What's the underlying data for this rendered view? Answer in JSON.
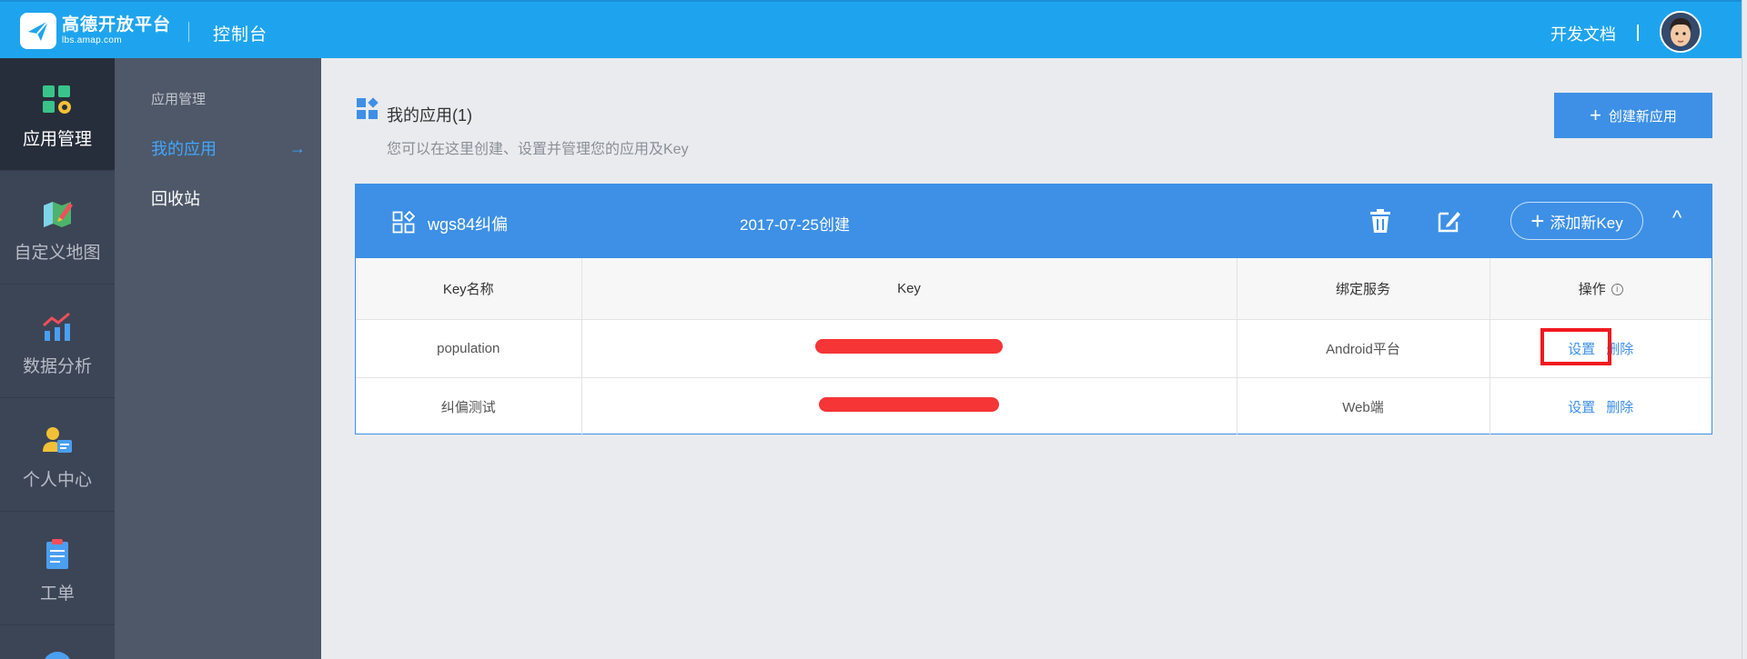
{
  "header": {
    "logo_title": "高德开放平台",
    "logo_sub": "lbs.amap.com",
    "console": "控制台",
    "docs": "开发文档",
    "avatar": "user-avatar"
  },
  "sidebar": {
    "items": [
      {
        "label": "应用管理",
        "icon": "app-management-icon"
      },
      {
        "label": "自定义地图",
        "icon": "custom-map-icon"
      },
      {
        "label": "数据分析",
        "icon": "data-analysis-icon"
      },
      {
        "label": "个人中心",
        "icon": "personal-center-icon"
      },
      {
        "label": "工单",
        "icon": "ticket-icon"
      }
    ],
    "active": 0
  },
  "subnav": {
    "heading": "应用管理",
    "items": [
      {
        "label": "我的应用",
        "active": true
      },
      {
        "label": "回收站",
        "active": false
      }
    ],
    "arrow": "→"
  },
  "main": {
    "title": "我的应用(1)",
    "subtitle": "您可以在这里创建、设置并管理您的应用及Key",
    "create_button": "创建新应用"
  },
  "app": {
    "name": "wgs84纠偏",
    "created": "2017-07-25创建",
    "add_key_button": "添加新Key",
    "collapse": "^"
  },
  "table": {
    "headers": [
      "Key名称",
      "Key",
      "绑定服务",
      "操作"
    ],
    "info_glyph": "i",
    "rows": [
      {
        "name": "population",
        "service": "Android平台",
        "settings": "设置",
        "delete": "删除"
      },
      {
        "name": "纠偏测试",
        "service": "Web端",
        "settings": "设置",
        "delete": "删除"
      }
    ]
  },
  "colors": {
    "topbar": "#1ea4ee",
    "accent": "#3d90e6",
    "sidebar": "#3c4556",
    "subnav": "#4e5868",
    "redaction": "#f63536",
    "highlight": "#f0191f"
  }
}
